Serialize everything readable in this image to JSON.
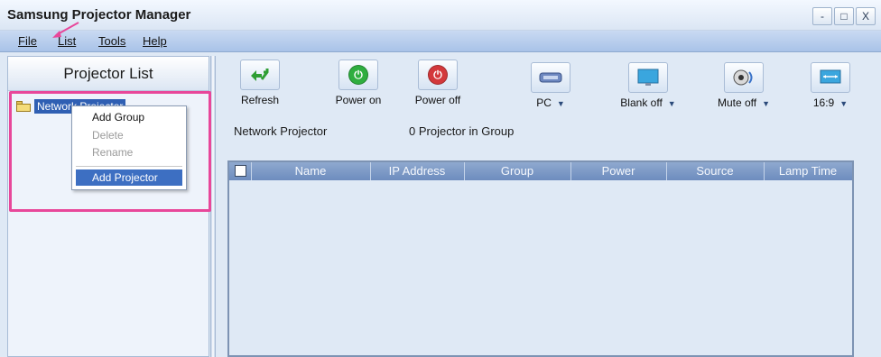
{
  "window": {
    "title": "Samsung Projector Manager",
    "controls": {
      "minimize": "-",
      "maximize": "□",
      "close": "X"
    }
  },
  "menu": {
    "file": "File",
    "list": "List",
    "tools": "Tools",
    "help": "Help"
  },
  "left_panel": {
    "title": "Projector List",
    "tree_item": "Network Projector"
  },
  "context_menu": {
    "add_group": "Add Group",
    "delete": "Delete",
    "rename": "Rename",
    "add_projector": "Add Projector"
  },
  "toolbar": {
    "refresh": "Refresh",
    "power_on": "Power on",
    "power_off": "Power off",
    "source": "PC",
    "blank": "Blank off",
    "mute": "Mute off",
    "aspect": "16:9"
  },
  "info": {
    "group_name": "Network Projector",
    "projector_count": "0 Projector in Group"
  },
  "table": {
    "columns": [
      "Name",
      "IP Address",
      "Group",
      "Power",
      "Source",
      "Lamp Time"
    ],
    "rows": []
  },
  "colors": {
    "highlight": "#e8479a",
    "selection": "#3d6fc2",
    "header": "#7b98c6"
  }
}
